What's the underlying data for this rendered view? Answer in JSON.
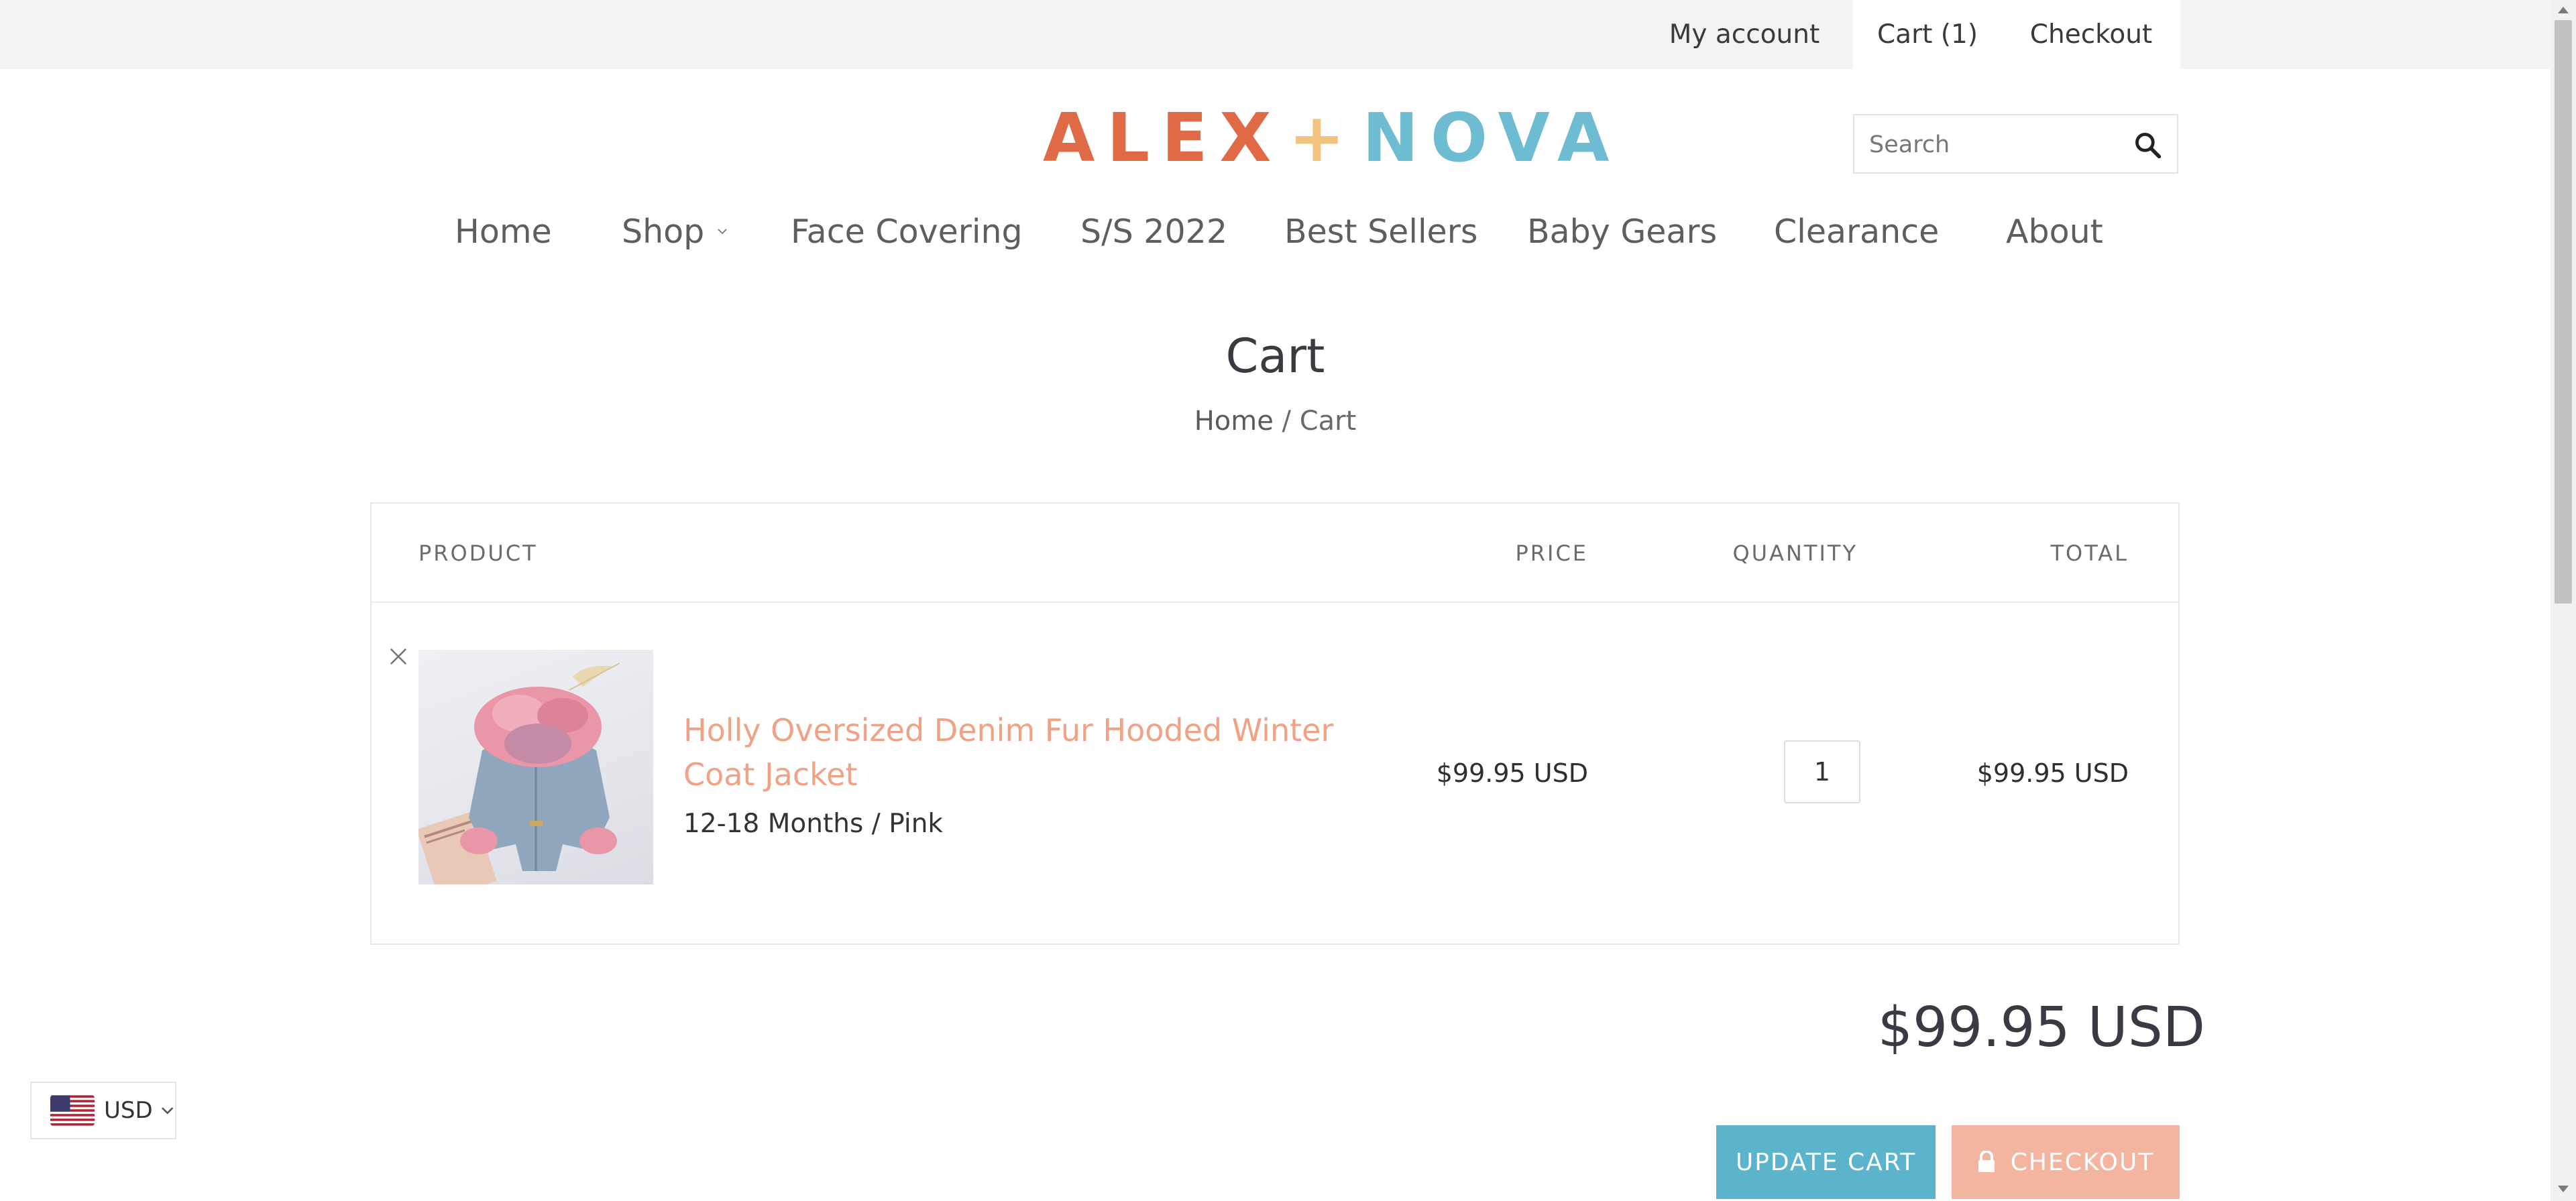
{
  "topbar": {
    "my_account": "My account",
    "cart": "Cart (1)",
    "checkout": "Checkout"
  },
  "brand": {
    "left": "ALEX",
    "plus": "+",
    "right": "NOVA",
    "colors": {
      "alex": "#e06a45",
      "plus": "#f2c27f",
      "nova": "#6dbcd1"
    }
  },
  "search": {
    "placeholder": "Search",
    "icon": "search-icon"
  },
  "nav": {
    "home": "Home",
    "shop": "Shop",
    "face_covering": "Face Covering",
    "ss2022": "S/S 2022",
    "best_sellers": "Best Sellers",
    "baby_gears": "Baby Gears",
    "clearance": "Clearance",
    "about": "About"
  },
  "page": {
    "title": "Cart",
    "breadcrumb_home": "Home",
    "breadcrumb_sep": "/",
    "breadcrumb_current": "Cart"
  },
  "table": {
    "headers": {
      "product": "PRODUCT",
      "price": "PRICE",
      "quantity": "QUANTITY",
      "total": "TOTAL"
    },
    "items": [
      {
        "name": "Holly Oversized Denim Fur Hooded Winter Coat Jacket",
        "variant": "12-18 Months / Pink",
        "price": "$99.95 USD",
        "quantity": "1",
        "total": "$99.95 USD"
      }
    ]
  },
  "subtotal": "$99.95 USD",
  "actions": {
    "update_cart": "UPDATE CART",
    "checkout": "CHECKOUT"
  },
  "currency": {
    "code": "USD",
    "flag": "us-flag-icon"
  },
  "colors": {
    "accent_blue": "#5bb4cb",
    "accent_peach": "#f4b5a0",
    "link_peach": "#f0a285"
  }
}
